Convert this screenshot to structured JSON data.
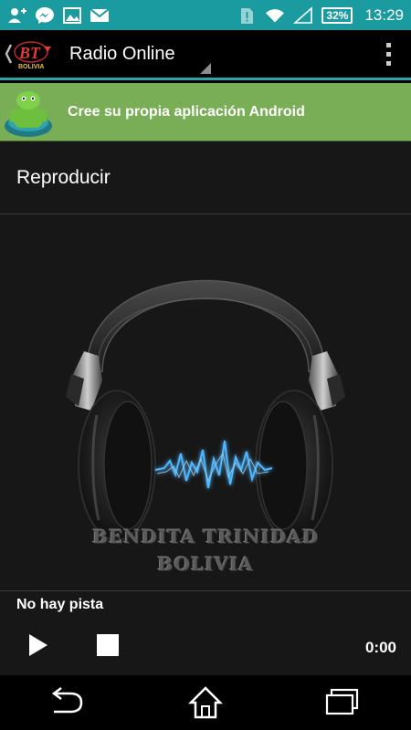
{
  "status_bar": {
    "icons_left": [
      "add-contact-icon",
      "messenger-icon",
      "image-icon",
      "mail-icon"
    ],
    "icons_right": [
      "sim-alert-icon",
      "wifi-icon",
      "signal-icon"
    ],
    "battery": "32%",
    "time": "13:29"
  },
  "action_bar": {
    "logo_text": "BT",
    "logo_subtext": "BOLIVIA",
    "title": "Radio Online"
  },
  "banner": {
    "text": "Cree su propia aplicación Android"
  },
  "section": {
    "title": "Reproducir"
  },
  "artwork": {
    "line1": "BENDITA TRINIDAD",
    "line2": "BOLIVIA"
  },
  "player": {
    "track": "No hay pista",
    "time": "0:00"
  },
  "colors": {
    "status_bar": "#1a9ba0",
    "accent": "#2aa6a7",
    "banner": "#7aae56",
    "wave": "#4fb7ff"
  }
}
